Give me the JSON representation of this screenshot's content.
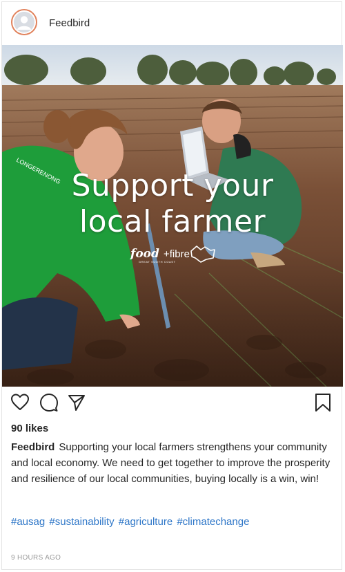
{
  "post": {
    "username": "Feedbird",
    "image": {
      "overlay_line1": "Support your",
      "overlay_line2": "local farmer",
      "brand_food": "food",
      "brand_fibre": "+fibre",
      "brand_tagline": "GREAT SOUTH COAST",
      "jacket_text": "LONGERENONG"
    },
    "likes": "90 likes",
    "caption_user": "Feedbird",
    "caption_text": "Supporting your local farmers strengthens your community and local economy. We need to get together to improve the prosperity and resilience of our local communities, buying locally is a win, win!",
    "hashtags": [
      "#ausag",
      "#sustainability",
      "#agriculture",
      "#climatechange"
    ],
    "timestamp": "9 HOURS AGO"
  },
  "icons": {
    "avatar": "user-avatar-icon",
    "like": "heart-icon",
    "comment": "comment-icon",
    "share": "send-icon",
    "save": "bookmark-icon"
  },
  "colors": {
    "hashtag": "#2f77c8",
    "avatar_ring": "#e1825c",
    "jacket_green": "#1e9d3a"
  }
}
